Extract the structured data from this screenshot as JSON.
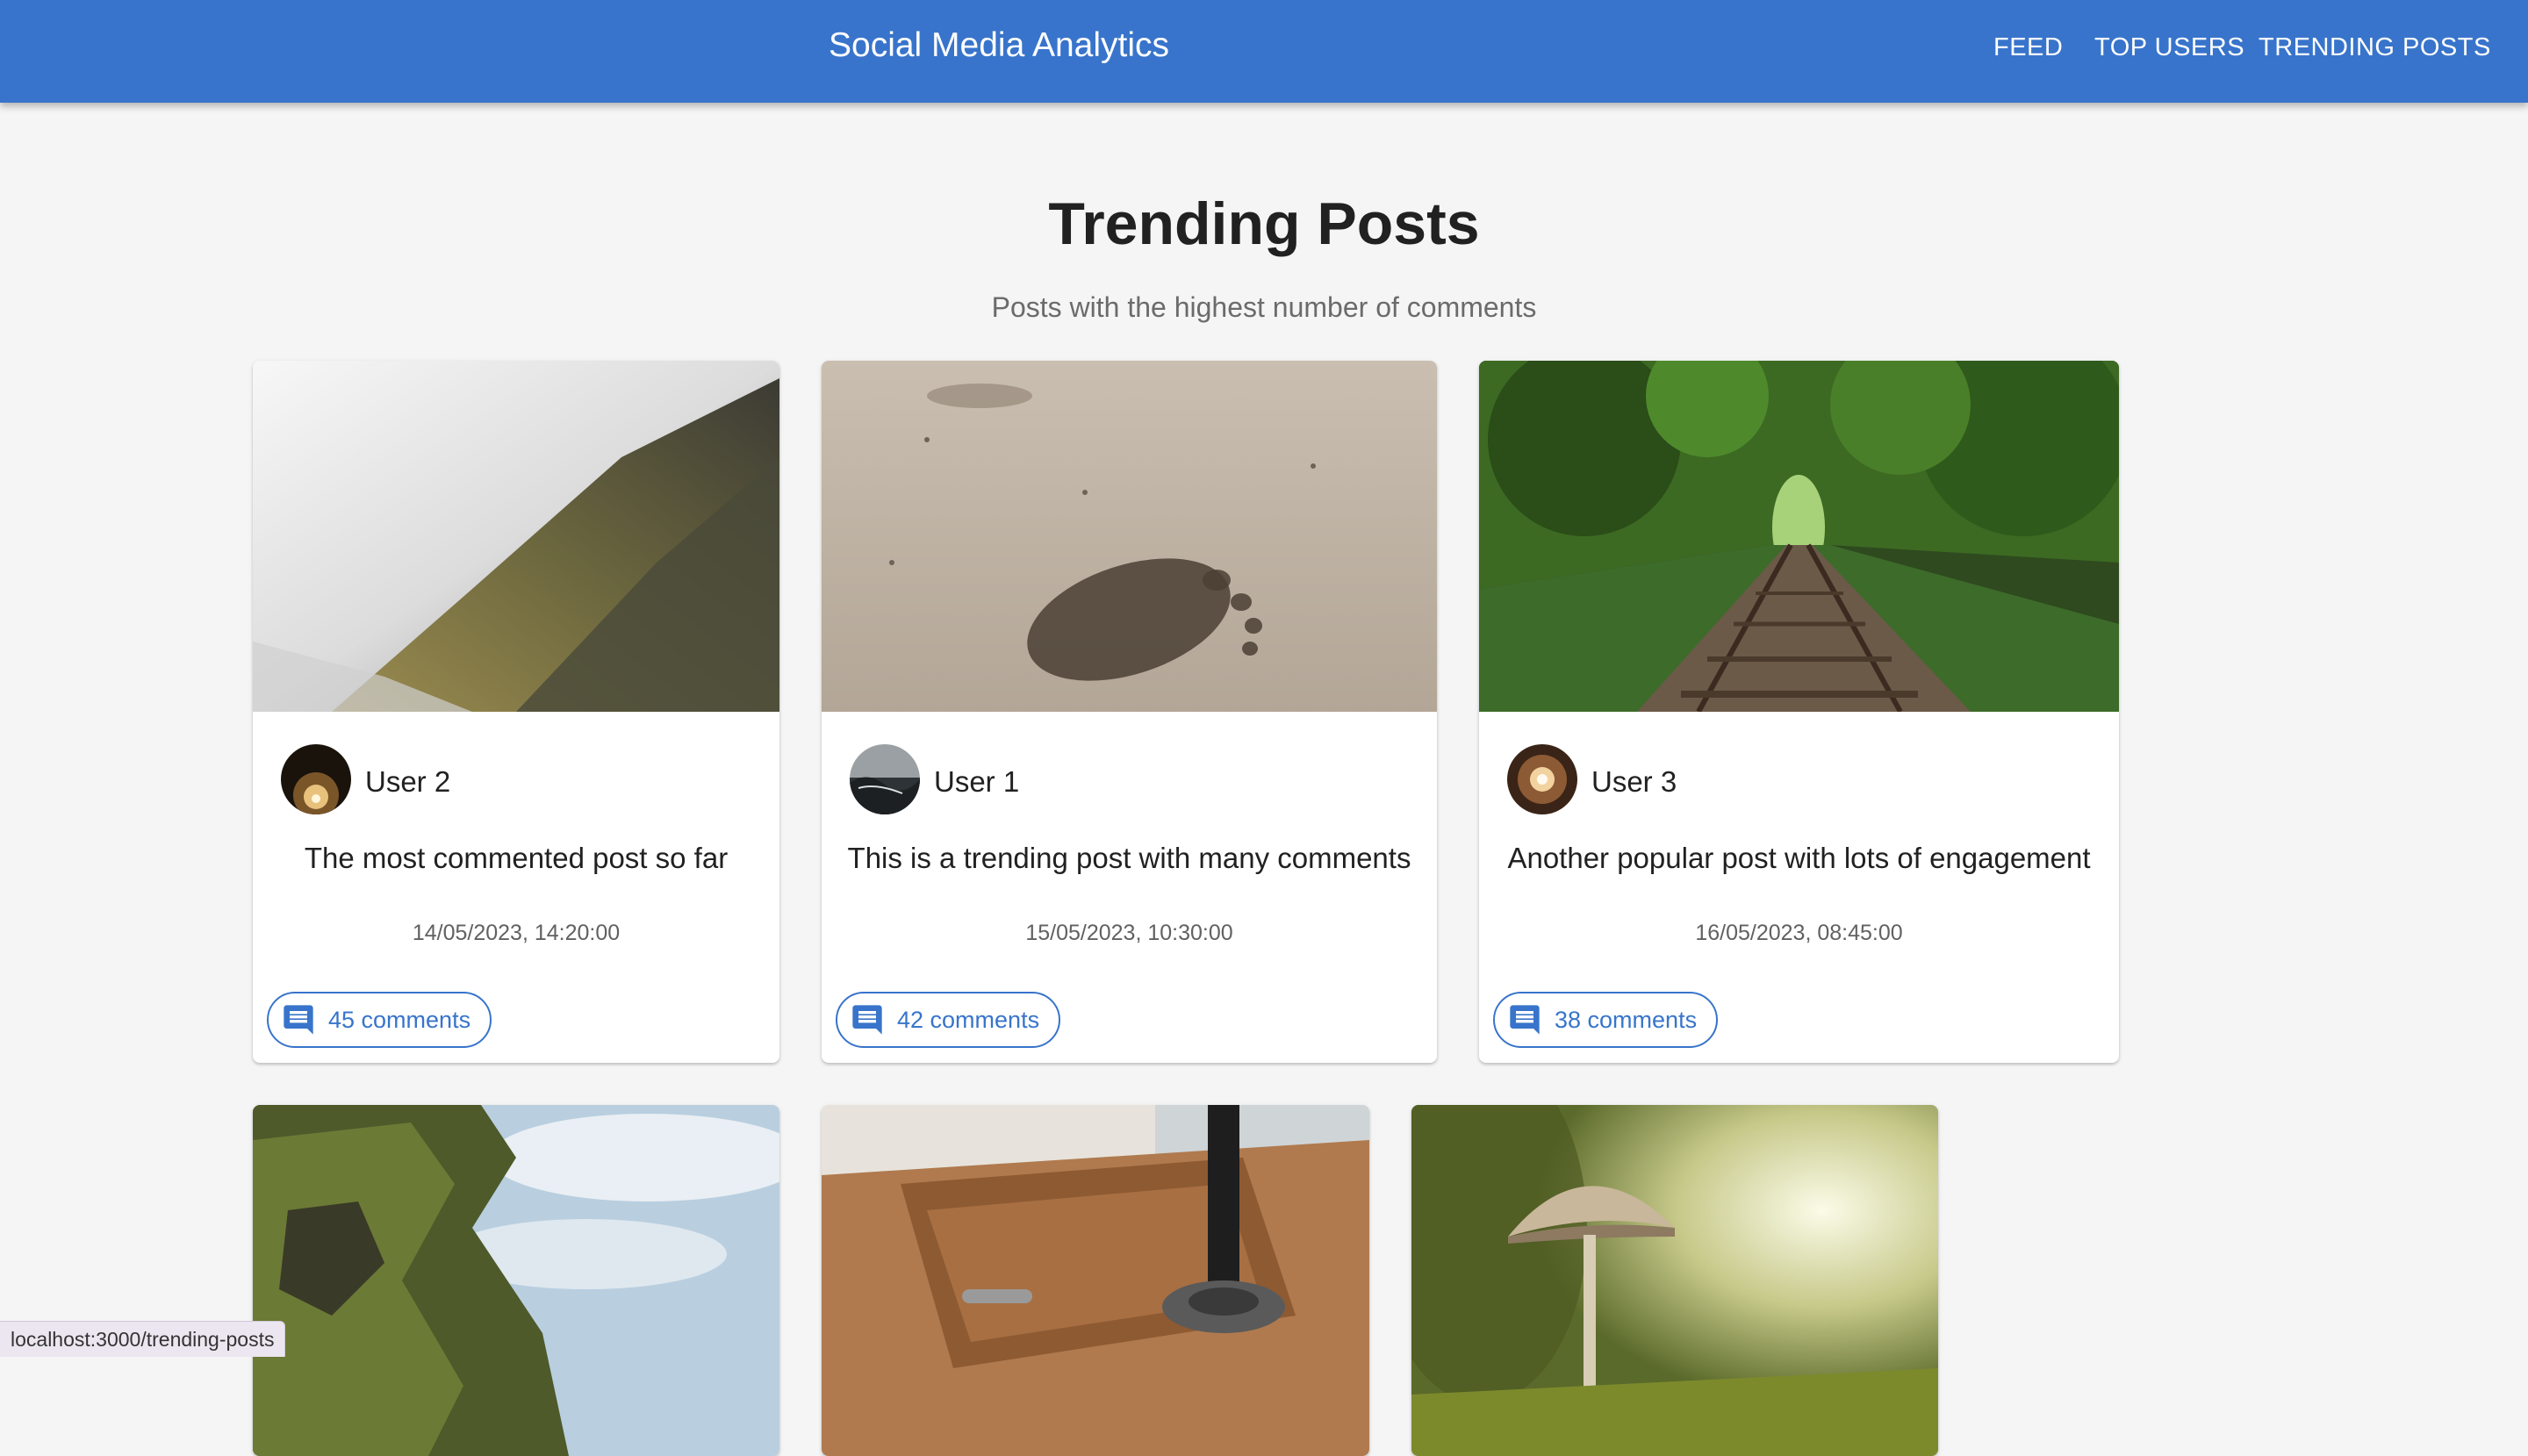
{
  "app": {
    "title": "Social Media Analytics"
  },
  "nav": {
    "feed": "FEED",
    "top_users": "TOP USERS",
    "trending_posts": "TRENDING POSTS"
  },
  "page": {
    "title": "Trending Posts",
    "subtitle": "Posts with the highest number of comments"
  },
  "posts": [
    {
      "user": "User 2",
      "text": "The most commented post so far",
      "date": "14/05/2023, 14:20:00",
      "comments": "45 comments",
      "image": "misty-forest-mountain",
      "avatar": "dark-cave-light"
    },
    {
      "user": "User 1",
      "text": "This is a trending post with many comments",
      "date": "15/05/2023, 10:30:00",
      "comments": "42 comments",
      "image": "footprint-in-sand",
      "avatar": "stormy-coast"
    },
    {
      "user": "User 3",
      "text": "Another popular post with lots of engagement",
      "date": "16/05/2023, 08:45:00",
      "comments": "38 comments",
      "image": "railway-through-forest",
      "avatar": "warm-lamp-glow"
    },
    {
      "image": "coastal-cliff"
    },
    {
      "image": "leather-notebook-desk"
    },
    {
      "image": "mushroom-macro"
    }
  ],
  "icons": {
    "comment": "comment-icon"
  },
  "colors": {
    "primary": "#3874cb",
    "background": "#f5f5f5"
  },
  "status_bar": {
    "url": "localhost:3000/trending-posts"
  }
}
